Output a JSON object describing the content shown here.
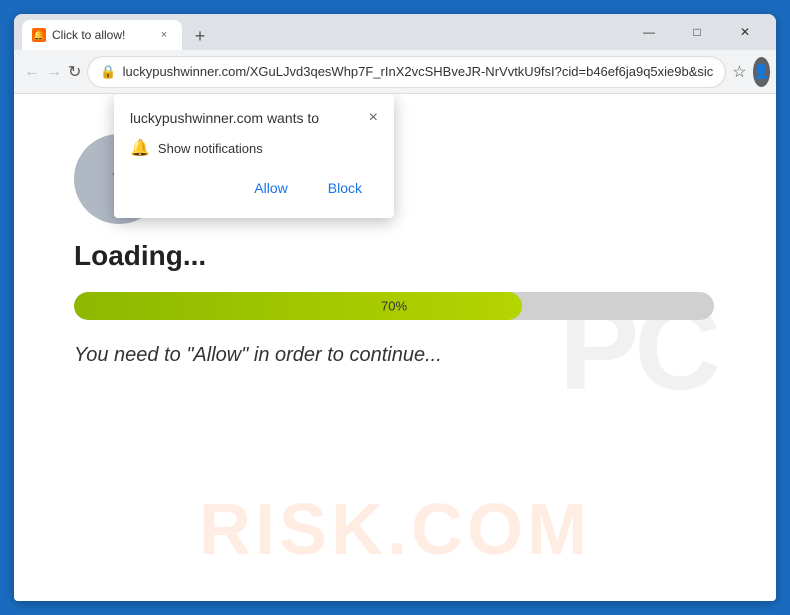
{
  "browser": {
    "tab": {
      "favicon": "🔔",
      "title": "Click to allow!",
      "close_label": "×"
    },
    "new_tab_label": "+",
    "window_controls": {
      "minimize": "—",
      "maximize": "□",
      "close": "✕"
    },
    "toolbar": {
      "back_label": "←",
      "forward_label": "→",
      "reload_label": "↻",
      "address": "luckypushwinner.com/XGuLJvd3qesWhp7F_rInX2vcSHBveJR-NrVvtkU9fsI?cid=b46ef6ja9q5xie9b&sic",
      "star_label": "☆",
      "menu_label": "⋮"
    }
  },
  "permission_popup": {
    "title": "luckypushwinner.com wants to",
    "close_label": "×",
    "notification_label": "Show notifications",
    "allow_label": "Allow",
    "block_label": "Block"
  },
  "page": {
    "loading_text": "Loading...",
    "progress_percent": 70,
    "progress_width": "70%",
    "progress_label": "70%",
    "allow_message": "You need to \"Allow\" in order to continue...",
    "watermark_pc": "PC",
    "watermark_risk": "RISK.COM"
  }
}
